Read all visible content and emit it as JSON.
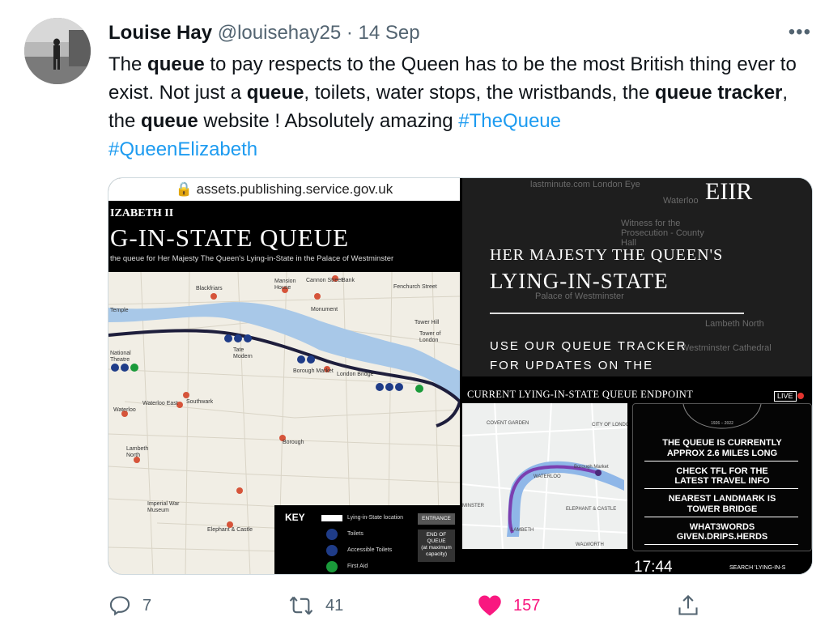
{
  "tweet": {
    "author_name": "Louise Hay",
    "handle": "@louisehay25",
    "separator": "·",
    "date": "14 Sep",
    "more_label": "•••",
    "text_parts": [
      {
        "t": "The ",
        "bold": false
      },
      {
        "t": "queue",
        "bold": true
      },
      {
        "t": " to pay respects to the Queen has to be the most British thing ever to exist. Not just a ",
        "bold": false
      },
      {
        "t": "queue",
        "bold": true
      },
      {
        "t": ", toilets, water stops, the wristbands, the ",
        "bold": false
      },
      {
        "t": "queue tracker",
        "bold": true
      },
      {
        "t": ", the ",
        "bold": false
      },
      {
        "t": "queue",
        "bold": true
      },
      {
        "t": " website ! Absolutely amazing ",
        "bold": false
      }
    ],
    "hashtags": [
      "#TheQueue",
      "#QueenElizabeth"
    ]
  },
  "media": {
    "map_image": {
      "url": "assets.publishing.service.gov.uk",
      "kicker": "IZABETH II",
      "title": "G-IN-STATE QUEUE",
      "subtitle": "the queue for Her Majesty The Queen's Lying-in-State in the Palace of Westminster",
      "places": [
        "Blackfriars",
        "Mansion House",
        "Cannon Street",
        "Bank",
        "Fenchurch Street",
        "Temple",
        "Monument",
        "Tower Hill",
        "Tower of London",
        "Tate Modern",
        "Borough Market",
        "London Bridge",
        "National Theatre",
        "Waterloo East",
        "Waterloo",
        "Southwark",
        "Borough",
        "Lambeth North",
        "Imperial War Museum",
        "Elephant & Castle"
      ],
      "key": {
        "title": "KEY",
        "items": [
          "Lying-in-State location",
          "Toilets",
          "Accessible Toilets",
          "First Aid"
        ],
        "entrance": "ENTRANCE",
        "end_of_queue": "END OF QUEUE",
        "end_of_queue_note": "(at maximum capacity)"
      }
    },
    "promo_image": {
      "logo": "EIIR",
      "line1": "HER MAJESTY THE QUEEN'S",
      "line2": "LYING-IN-STATE",
      "line3": "USE OUR QUEUE TRACKER",
      "line4": "FOR UPDATES ON THE",
      "bg_labels": [
        "lastminute.com London Eye",
        "Waterloo",
        "Witness for the Prosecution - County Hall",
        "Palace of Westminster",
        "Lambeth North",
        "Westminster Cathedral"
      ]
    },
    "tracker_image": {
      "header": "CURRENT LYING-IN-STATE QUEUE ENDPOINT",
      "live": "LIVE",
      "years": "1926 – 2022",
      "lines": [
        "THE QUEUE IS CURRENTLY",
        "APPROX 2.6 MILES LONG",
        "CHECK TFL FOR THE",
        "LATEST TRAVEL INFO",
        "NEAREST LANDMARK IS",
        "TOWER BRIDGE",
        "WHAT3WORDS",
        "GIVEN.DRIPS.HERDS"
      ],
      "clock": "17:44",
      "search": "SEARCH 'LYING-IN-S",
      "map_labels": [
        "COVENT GARDEN",
        "WATERLOO",
        "LAMBETH",
        "ELEPHANT & CASTLE",
        "WALWORTH",
        "CITY OF LONDON",
        "MINSTER",
        "Borough Market"
      ]
    }
  },
  "actions": {
    "replies": "7",
    "retweets": "41",
    "likes": "157"
  },
  "colors": {
    "link": "#1d9bf0",
    "like": "#f91880",
    "muted": "#536471",
    "thames": "#a8c8e8",
    "queue_line": "#1e1e3c"
  }
}
